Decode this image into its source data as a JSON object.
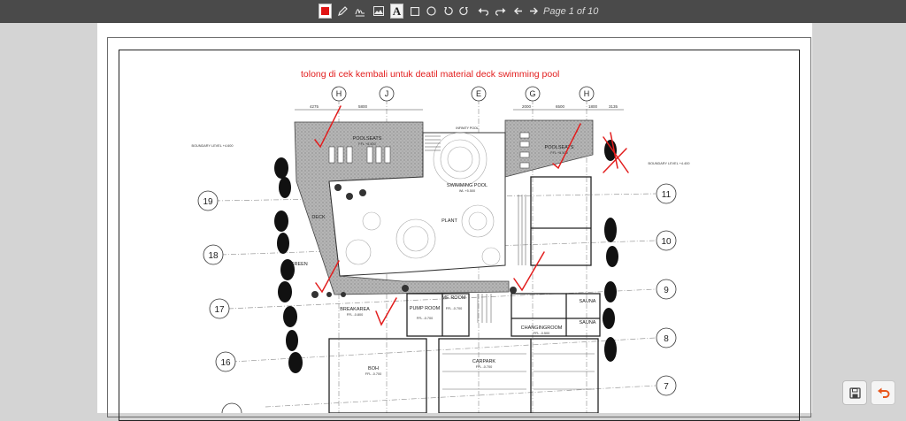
{
  "toolbar": {
    "tools": [
      {
        "name": "color-picker",
        "icon": "red-square-icon"
      },
      {
        "name": "pencil",
        "icon": "pencil-icon"
      },
      {
        "name": "signature",
        "icon": "signature-icon"
      },
      {
        "name": "image",
        "icon": "image-icon"
      },
      {
        "name": "text",
        "icon": "text-a-icon",
        "label": "A"
      },
      {
        "name": "rectangle",
        "icon": "square-icon"
      },
      {
        "name": "circle",
        "icon": "circle-icon"
      },
      {
        "name": "rotate-left",
        "icon": "rotate-left-icon"
      },
      {
        "name": "rotate-right",
        "icon": "rotate-right-icon"
      },
      {
        "name": "undo",
        "icon": "undo-icon"
      },
      {
        "name": "redo",
        "icon": "redo-icon"
      },
      {
        "name": "prev-page",
        "icon": "arrow-left-icon"
      },
      {
        "name": "next-page",
        "icon": "arrow-right-icon"
      }
    ],
    "page_indicator": "Page 1 of 10",
    "selected_color": "#e01414"
  },
  "document": {
    "annotation_note": "tolong di cek kembali untuk deatil material deck swimming pool",
    "annotation_color": "#e21d1d",
    "grid_top_labels": [
      "H",
      "J",
      "E",
      "G",
      "H"
    ],
    "grid_right_labels": [
      "11",
      "10",
      "9",
      "8",
      "7"
    ],
    "grid_left_labels": [
      "19",
      "18",
      "17",
      "16"
    ],
    "dimension_labels": [
      "4275",
      "5800",
      "2000",
      "6500",
      "1800",
      "3135"
    ],
    "room_labels": {
      "pool_seats_left": "POOLSEATS",
      "pool_seats_right": "POOLSEATS",
      "swimming_pool": "SWIMMING POOL",
      "deck": "DECK",
      "green": "GREEN",
      "break_area": "BREAKAREA",
      "pump_room": "PUMP ROOM",
      "me_room": "ME ROOM",
      "sauna_top": "SAUNA",
      "sauna_bottom": "SAUNA",
      "changing_room": "CHANGINGROOM",
      "boh": "BOH",
      "carpark": "CARPARK",
      "infinity_pool": "INFINITY POOL",
      "plant": "PLANT"
    },
    "level_labels": {
      "pool_seats_left": "FFL +5.500",
      "pool_seats_right": "FFL +5.500",
      "swimming_pool": "WL +5.500",
      "break_area": "FFL -0.800",
      "pump_room": "FFL -0.700",
      "me_room": "FFL -0.700",
      "changing_room": "FFL -0.500",
      "boh": "FFL -0.700",
      "carpark": "FFL -0.700",
      "boundary_left": "BOUNDARY LEVEL +4.600",
      "boundary_right": "BOUNDARY LEVEL +4.400"
    }
  },
  "actions": {
    "save_icon": "floppy-disk-icon",
    "undo_icon": "undo-arrow-icon",
    "undo_color": "#e8561b"
  }
}
